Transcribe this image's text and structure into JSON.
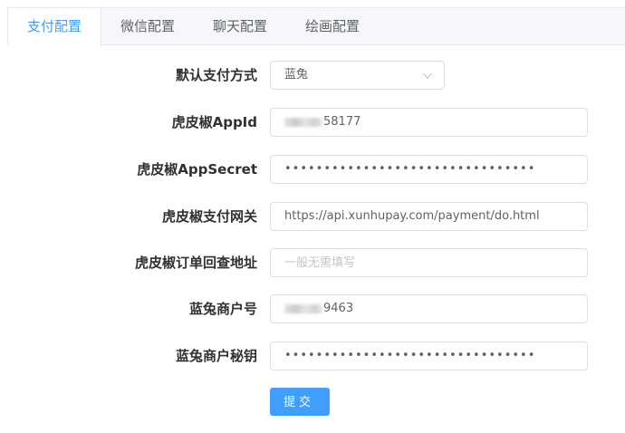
{
  "tabs": [
    {
      "label": "支付配置",
      "active": true
    },
    {
      "label": "微信配置",
      "active": false
    },
    {
      "label": "聊天配置",
      "active": false
    },
    {
      "label": "绘画配置",
      "active": false
    }
  ],
  "form": {
    "default_method": {
      "label": "默认支付方式",
      "value": "蓝兔"
    },
    "hupijiao_appid": {
      "label": "虎皮椒AppId",
      "value": "58177"
    },
    "hupijiao_secret": {
      "label": "虎皮椒AppSecret",
      "value": "••••••••••••••••••••••••••••••••"
    },
    "hupijiao_gateway": {
      "label": "虎皮椒支付网关",
      "value": "https://api.xunhupay.com/payment/do.html"
    },
    "hupijiao_query": {
      "label": "虎皮椒订单回查地址",
      "placeholder": "一般无需填写"
    },
    "lantu_merchant": {
      "label": "蓝兔商户号",
      "value": "9463"
    },
    "lantu_secret": {
      "label": "蓝兔商户秘钥",
      "value": "••••••••••••••••••••••••••••••••"
    }
  },
  "submit_label": "提交",
  "colors": {
    "accent": "#409eff",
    "border": "#dcdfe6",
    "tab_bg": "#f5f7fa"
  }
}
